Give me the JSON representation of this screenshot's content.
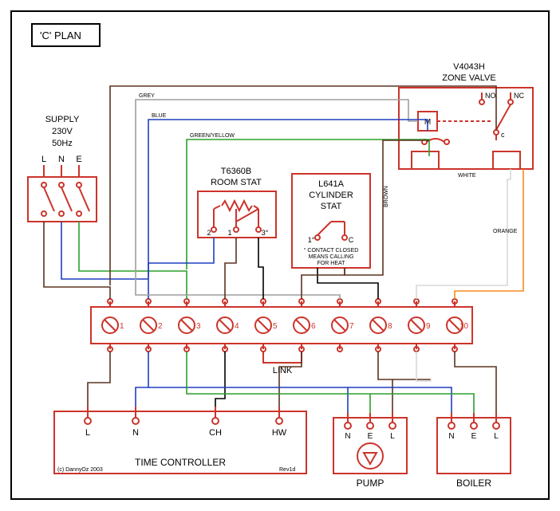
{
  "title": "'C' PLAN",
  "supply": {
    "title": "SUPPLY",
    "voltage": "230V",
    "freq": "50Hz",
    "L": "L",
    "N": "N",
    "E": "E"
  },
  "roomstat": {
    "model": "T6360B",
    "name": "ROOM STAT",
    "pin2": "2",
    "pin1": "1",
    "pin3": "3°"
  },
  "cylstat": {
    "model": "L641A",
    "name1": "CYLINDER",
    "name2": "STAT",
    "pin1": "1°",
    "pinC": "C",
    "note1": "° CONTACT CLOSED",
    "note2": "MEANS CALLING",
    "note3": "FOR HEAT"
  },
  "zonevalve": {
    "model": "V4043H",
    "name": "ZONE VALVE",
    "M": "M",
    "c": "c",
    "NO": "NO",
    "NC": "NC"
  },
  "strip": {
    "t1": "1",
    "t2": "2",
    "t3": "3",
    "t4": "4",
    "t5": "5",
    "t6": "6",
    "t7": "7",
    "t8": "8",
    "t9": "9",
    "t10": "10",
    "link": "LINK"
  },
  "timec": {
    "name": "TIME CONTROLLER",
    "L": "L",
    "N": "N",
    "CH": "CH",
    "HW": "HW"
  },
  "pump": {
    "name": "PUMP",
    "N": "N",
    "E": "E",
    "L": "L"
  },
  "boiler": {
    "name": "BOILER",
    "N": "N",
    "E": "E",
    "L": "L"
  },
  "wcol": {
    "grey": "GREY",
    "blue": "BLUE",
    "greenyellow": "GREEN/YELLOW",
    "white": "WHITE",
    "orange": "ORANGE",
    "brown": "BROWN"
  },
  "copyright": "(c) DannyOz 2003",
  "rev": "Rev1d"
}
